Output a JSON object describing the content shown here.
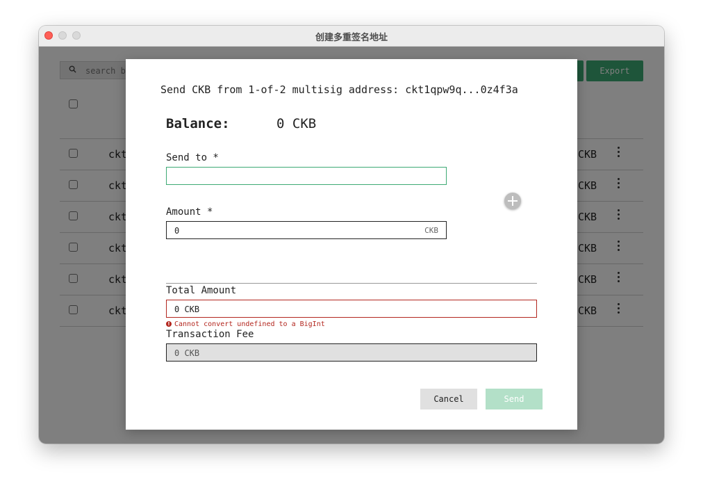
{
  "window": {
    "title": "创建多重签名地址"
  },
  "background": {
    "search_placeholder": "search b",
    "partial_button_label": "",
    "export_label": "Export",
    "rows": [
      {
        "address": "ckt",
        "balance": "CKB"
      },
      {
        "address": "ckt",
        "balance": "CKB"
      },
      {
        "address": "ckt",
        "balance": "CKB"
      },
      {
        "address": "ckt",
        "balance": "CKB"
      },
      {
        "address": "ckt",
        "balance": "CKB"
      },
      {
        "address": "ckt",
        "balance": "CKB"
      }
    ]
  },
  "dialog": {
    "title": "Send CKB from 1-of-2 multisig address: ckt1qpw9q...0z4f3a",
    "balance_label": "Balance:",
    "balance_value": "0 CKB",
    "send_to_label": "Send to *",
    "send_to_value": "",
    "amount_label": "Amount *",
    "amount_value": "0",
    "amount_unit": "CKB",
    "total_amount_label": "Total Amount",
    "total_amount_value": "0 CKB",
    "error_message": "Cannot convert undefined to a BigInt",
    "transaction_fee_label": "Transaction Fee",
    "transaction_fee_value": "0 CKB",
    "cancel_label": "Cancel",
    "send_label": "Send"
  },
  "colors": {
    "accent": "#3daa74",
    "error": "#b3261e",
    "send_disabled": "#b3e0c8"
  }
}
